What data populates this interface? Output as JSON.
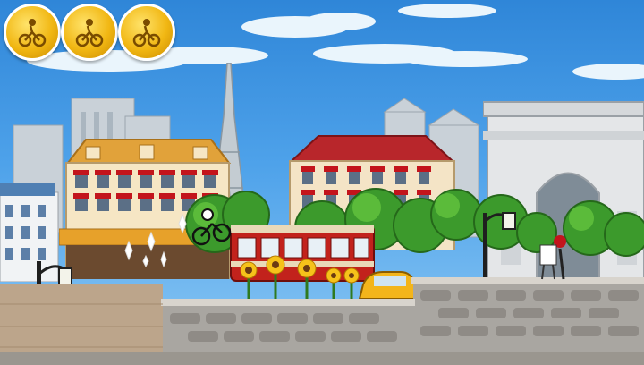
{
  "hud": {
    "medals": [
      {
        "icon": "bike-rider-medal-icon",
        "state": "collected"
      },
      {
        "icon": "bike-rider-medal-icon",
        "state": "collected"
      },
      {
        "icon": "bike-rider-medal-icon",
        "state": "collected"
      }
    ]
  },
  "scene": {
    "setting": "Paris",
    "landmarks": [
      "eiffel-tower",
      "arc-de-triomphe",
      "notre-dame-towers"
    ],
    "colors": {
      "sky": "#3d95e2",
      "stone_wall": "#a9a6a1",
      "tram": "#c2221c",
      "coin_gold": "#f1b713",
      "awning_red": "#c3141c"
    }
  }
}
